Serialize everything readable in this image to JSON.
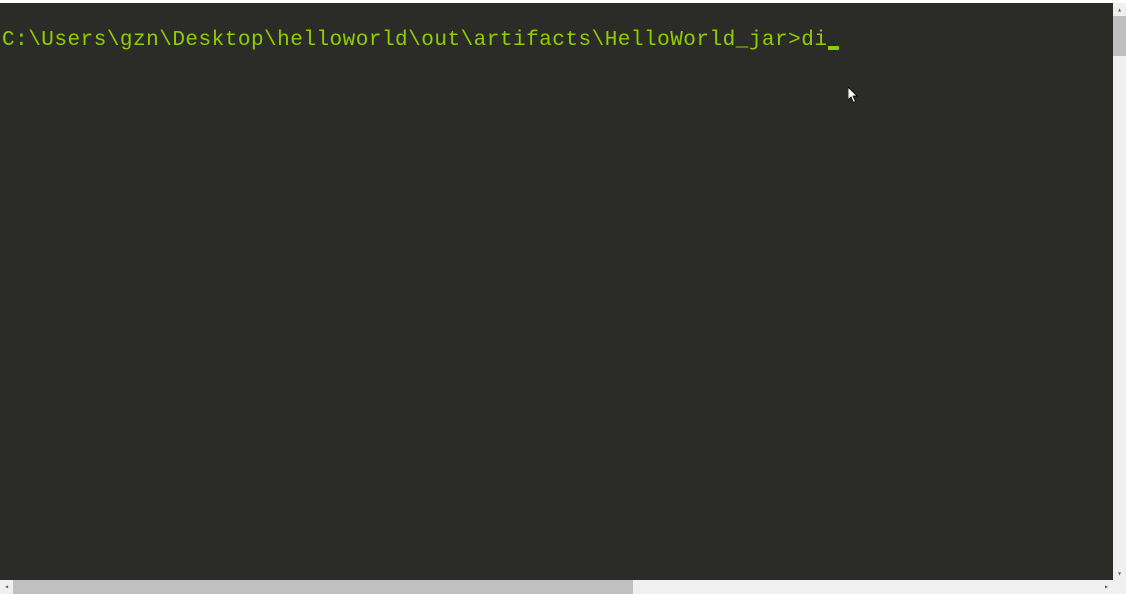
{
  "terminal": {
    "prompt": "C:\\Users\\gzn\\Desktop\\helloworld\\out\\artifacts\\HelloWorld_jar>",
    "typed_command": "di"
  },
  "scrollbar": {
    "up_arrow": "▴",
    "down_arrow": "▾",
    "left_arrow": "◂",
    "right_arrow": "▸"
  }
}
